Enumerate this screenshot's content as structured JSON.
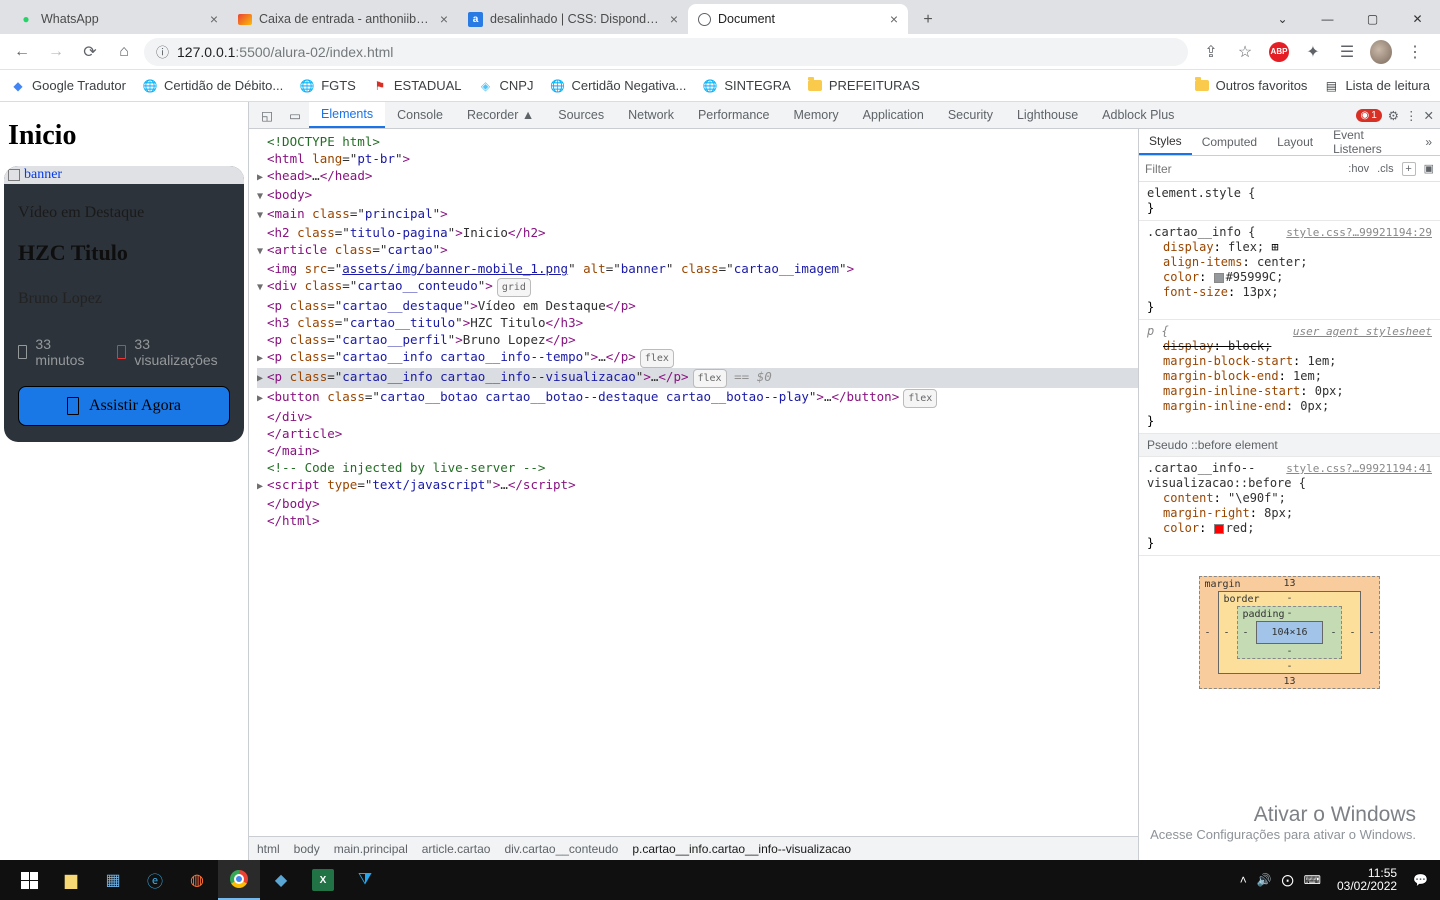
{
  "tabs": [
    {
      "title": "WhatsApp",
      "favicon": "green"
    },
    {
      "title": "Caixa de entrada - anthoniibs@g",
      "favicon": "gmail"
    },
    {
      "title": "desalinhado | CSS: Dispondo ele",
      "favicon": "alura"
    },
    {
      "title": "Document",
      "favicon": "globe",
      "active": true
    }
  ],
  "address": {
    "host": "127.0.0.1",
    "rest": ":5500/alura-02/index.html",
    "info_icon": "ⓘ"
  },
  "bookmarks": [
    "Google Tradutor",
    "Certidão de Débito...",
    "FGTS",
    "ESTADUAL",
    "CNPJ",
    "Certidão Negativa...",
    "SINTEGRA",
    "PREFEITURAS"
  ],
  "bookmarks_right": [
    "Outros favoritos",
    "Lista de leitura"
  ],
  "page": {
    "heading": "Inicio",
    "banner_alt": "banner",
    "destaque": "Vídeo em Destaque",
    "titulo": "HZC Titulo",
    "perfil": "Bruno Lopez",
    "tempo": "33 minutos",
    "visualizacoes": "33 visualizações",
    "botao": "Assistir Agora"
  },
  "devtools": {
    "tabs": [
      "Elements",
      "Console",
      "Recorder ▲",
      "Sources",
      "Network",
      "Performance",
      "Memory",
      "Application",
      "Security",
      "Lighthouse",
      "Adblock Plus"
    ],
    "active_tab": "Elements",
    "error_count": "1",
    "side_tabs": [
      "Styles",
      "Computed",
      "Layout",
      "Event Listeners"
    ],
    "side_active": "Styles",
    "filter_placeholder": "Filter",
    "hov": ":hov",
    "cls": ".cls",
    "breadcrumbs": [
      "html",
      "body",
      "main.principal",
      "article.cartao",
      "div.cartao__conteudo",
      "p.cartao__info.cartao__info--visualizacao"
    ],
    "rules": {
      "elstyle": "element.style {",
      "cartao_info": {
        "src": "style.css?…99921194:29",
        "sel": ".cartao__info {",
        "props": [
          [
            "display",
            "flex;"
          ],
          [
            "align-items",
            "center;"
          ],
          [
            "color",
            "#95999C;"
          ],
          [
            "font-size",
            "13px;"
          ]
        ]
      },
      "p_ua": {
        "src": "user agent stylesheet",
        "sel": "p {",
        "props": [
          [
            "display",
            "block;",
            true
          ],
          [
            "margin-block-start",
            "1em;"
          ],
          [
            "margin-block-end",
            "1em;"
          ],
          [
            "margin-inline-start",
            "0px;"
          ],
          [
            "margin-inline-end",
            "0px;"
          ]
        ]
      },
      "pseudo_hdr": "Pseudo ::before element",
      "visualizacao": {
        "src": "style.css?…99921194:41",
        "sel": ".cartao__info--visualizacao::before {",
        "props": [
          [
            "content",
            "\"\\e90f\";"
          ],
          [
            "margin-right",
            "8px;"
          ],
          [
            "color",
            "red;"
          ]
        ]
      }
    },
    "boxmodel": {
      "content": "104×16",
      "margin_top": "13",
      "margin_bottom": "13"
    }
  },
  "dom_lines": [
    {
      "ind": 0,
      "html": "<span class='cm'>&lt;!DOCTYPE html&gt;</span>"
    },
    {
      "ind": 0,
      "html": "<span class='tg'>&lt;html</span> <span class='at'>lang</span>=\"<span class='av'>pt-br</span>\"<span class='tg'>&gt;</span>"
    },
    {
      "ind": 1,
      "arrow": "▶",
      "html": "<span class='tg'>&lt;head&gt;</span>…<span class='tg'>&lt;/head&gt;</span>"
    },
    {
      "ind": 1,
      "arrow": "▼",
      "html": "<span class='tg'>&lt;body&gt;</span>"
    },
    {
      "ind": 2,
      "arrow": "▼",
      "html": "<span class='tg'>&lt;main</span> <span class='at'>class</span>=\"<span class='av'>principal</span>\"<span class='tg'>&gt;</span>"
    },
    {
      "ind": 3,
      "html": "<span class='tg'>&lt;h2</span> <span class='at'>class</span>=\"<span class='av'>titulo-pagina</span>\"<span class='tg'>&gt;</span>Inicio<span class='tg'>&lt;/h2&gt;</span>"
    },
    {
      "ind": 3,
      "arrow": "▼",
      "html": "<span class='tg'>&lt;article</span> <span class='at'>class</span>=\"<span class='av'>cartao</span>\"<span class='tg'>&gt;</span>"
    },
    {
      "ind": 4,
      "html": "<span class='tg'>&lt;img</span> <span class='at'>src</span>=\"<span class='lnk'>assets/img/banner-mobile_1.png</span>\" <span class='at'>alt</span>=\"<span class='av'>banner</span>\" <span class='at'>class</span>=\"<span class='av'>cartao__imagem</span>\"<span class='tg'>&gt;</span>"
    },
    {
      "ind": 4,
      "arrow": "▼",
      "html": "<span class='tg'>&lt;div</span> <span class='at'>class</span>=\"<span class='av'>cartao__conteudo</span>\"<span class='tg'>&gt;</span><span class='badge'>grid</span>"
    },
    {
      "ind": 5,
      "html": "<span class='tg'>&lt;p</span> <span class='at'>class</span>=\"<span class='av'>cartao__destaque</span>\"<span class='tg'>&gt;</span>Vídeo em Destaque<span class='tg'>&lt;/p&gt;</span>"
    },
    {
      "ind": 5,
      "html": "<span class='tg'>&lt;h3</span> <span class='at'>class</span>=\"<span class='av'>cartao__titulo</span>\"<span class='tg'>&gt;</span>HZC Titulo<span class='tg'>&lt;/h3&gt;</span>"
    },
    {
      "ind": 5,
      "html": "<span class='tg'>&lt;p</span> <span class='at'>class</span>=\"<span class='av'>cartao__perfil</span>\"<span class='tg'>&gt;</span>Bruno Lopez<span class='tg'>&lt;/p&gt;</span>"
    },
    {
      "ind": 5,
      "arrow": "▶",
      "html": "<span class='tg'>&lt;p</span> <span class='at'>class</span>=\"<span class='av'>cartao__info cartao__info--tempo</span>\"<span class='tg'>&gt;</span>…<span class='tg'>&lt;/p&gt;</span><span class='badge'>flex</span>"
    },
    {
      "ind": 5,
      "arrow": "▶",
      "sel": true,
      "html": "<span class='tg'>&lt;p</span> <span class='at'>class</span>=\"<span class='av'>cartao__info cartao__info--visualizacao</span>\"<span class='tg'>&gt;</span>…<span class='tg'>&lt;/p&gt;</span><span class='badge'>flex</span> <span class='dim'>== $0</span>"
    },
    {
      "ind": 5,
      "arrow": "▶",
      "html": "<span class='tg'>&lt;button</span> <span class='at'>class</span>=\"<span class='av'>cartao__botao cartao__botao--destaque cartao__botao--play</span>\"<span class='tg'>&gt;</span>…<span class='tg'>&lt;/button&gt;</span><span class='badge'>flex</span>"
    },
    {
      "ind": 4,
      "html": "<span class='tg'>&lt;/div&gt;</span>"
    },
    {
      "ind": 3,
      "html": "<span class='tg'>&lt;/article&gt;</span>"
    },
    {
      "ind": 2,
      "html": "<span class='tg'>&lt;/main&gt;</span>"
    },
    {
      "ind": 2,
      "html": "<span class='cm'>&lt;!-- Code injected by live-server --&gt;</span>"
    },
    {
      "ind": 2,
      "arrow": "▶",
      "html": "<span class='tg'>&lt;script</span> <span class='at'>type</span>=\"<span class='av'>text/javascript</span>\"<span class='tg'>&gt;</span>…<span class='tg'>&lt;/script&gt;</span>"
    },
    {
      "ind": 1,
      "html": "<span class='tg'>&lt;/body&gt;</span>"
    },
    {
      "ind": 0,
      "html": "<span class='tg'>&lt;/html&gt;</span>"
    }
  ],
  "watermark": {
    "l1": "Ativar o Windows",
    "l2": "Acesse Configurações para ativar o Windows."
  },
  "clock": {
    "time": "11:55",
    "date": "03/02/2022"
  }
}
